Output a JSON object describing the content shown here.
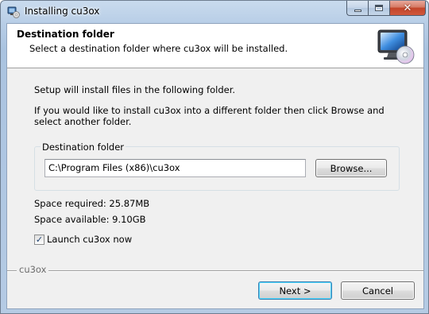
{
  "window": {
    "title": "Installing cu3ox"
  },
  "header": {
    "title": "Destination folder",
    "subtitle": "Select a destination folder where cu3ox will be installed."
  },
  "body": {
    "intro": "Setup will install files in the following folder.",
    "instructions_line1": "If you would like to install cu3ox into a different folder then click Browse and",
    "instructions_line2": "select another folder."
  },
  "destination": {
    "group_label": "Destination folder",
    "path_value": "C:\\Program Files (x86)\\cu3ox",
    "browse_label": "Browse..."
  },
  "space": {
    "required": "Space required: 25.87MB",
    "available": "Space available: 9.10GB"
  },
  "launch": {
    "label": "Launch cu3ox now",
    "checked": true
  },
  "footer": {
    "brand": "cu3ox",
    "next_label": "Next >",
    "cancel_label": "Cancel"
  },
  "icons": {
    "app": "installer-app-icon",
    "header": "monitor-cd-icon",
    "close": "close-icon",
    "minimize": "minimize-icon",
    "maximize": "maximize-icon"
  }
}
